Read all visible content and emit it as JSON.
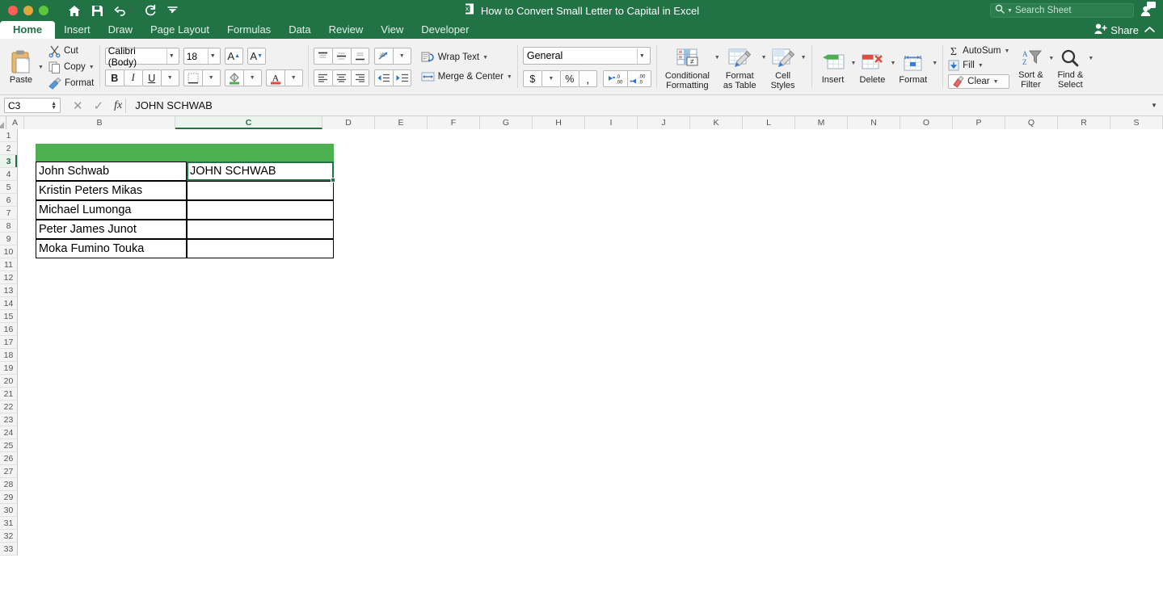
{
  "window": {
    "title": "How to Convert Small Letter to Capital in Excel",
    "doc_icon": "excel-document-icon",
    "traffic_lights": [
      "close",
      "minimize",
      "maximize"
    ],
    "quick_access": [
      {
        "name": "home-icon",
        "label": "Home"
      },
      {
        "name": "save-icon",
        "label": "Save"
      },
      {
        "name": "undo-icon",
        "label": "Undo"
      },
      {
        "name": "redo-icon",
        "label": "Redo"
      },
      {
        "name": "customize-toolbar-icon",
        "label": "Customize"
      }
    ],
    "search": {
      "placeholder": "Search Sheet",
      "icon": "search-icon"
    },
    "share_label": "Share",
    "account_icon": "account-comment-icon",
    "collapse_icon": "chevron-up-icon"
  },
  "tabs": [
    {
      "label": "Home",
      "active": true
    },
    {
      "label": "Insert",
      "active": false
    },
    {
      "label": "Draw",
      "active": false
    },
    {
      "label": "Page Layout",
      "active": false
    },
    {
      "label": "Formulas",
      "active": false
    },
    {
      "label": "Data",
      "active": false
    },
    {
      "label": "Review",
      "active": false
    },
    {
      "label": "View",
      "active": false
    },
    {
      "label": "Developer",
      "active": false
    }
  ],
  "ribbon": {
    "clipboard": {
      "paste": "Paste",
      "cut": "Cut",
      "copy": "Copy",
      "format_painter": "Format"
    },
    "font": {
      "name": "Calibri (Body)",
      "size": "18",
      "grow_label": "A",
      "shrink_label": "A",
      "bold": "B",
      "italic": "I",
      "underline": "U",
      "fill_color": "#4CAF50",
      "font_color": "#E8453C"
    },
    "alignment": {
      "wrap_text": "Wrap Text",
      "merge_center": "Merge & Center",
      "vertical_selected": "bottom",
      "horizontal_selected": "none"
    },
    "number": {
      "format": "General",
      "currency": "$",
      "percent": "%",
      "comma": ",",
      "increase_decimal": ".00",
      "decrease_decimal": ".0"
    },
    "styles": {
      "conditional_formatting": "Conditional\nFormatting",
      "conditional_formatting_l1": "Conditional",
      "conditional_formatting_l2": "Formatting",
      "format_as_table_l1": "Format",
      "format_as_table_l2": "as Table",
      "cell_styles_l1": "Cell",
      "cell_styles_l2": "Styles"
    },
    "cells": {
      "insert": "Insert",
      "delete": "Delete",
      "format": "Format"
    },
    "editing": {
      "autosum": "AutoSum",
      "fill": "Fill",
      "clear": "Clear",
      "sort_filter_l1": "Sort &",
      "sort_filter_l2": "Filter",
      "find_select_l1": "Find &",
      "find_select_l2": "Select"
    }
  },
  "formula_bar": {
    "name_box": "C3",
    "cancel_icon": "cancel-icon",
    "enter_icon": "check-icon",
    "function_icon": "fx",
    "content": "JOHN SCHWAB"
  },
  "sheet": {
    "columns": [
      "A",
      "B",
      "C",
      "D",
      "E",
      "F",
      "G",
      "H",
      "I",
      "J",
      "K",
      "L",
      "M",
      "N",
      "O",
      "P",
      "Q",
      "R",
      "S"
    ],
    "selected_column": "C",
    "rows": [
      1,
      2,
      3,
      4,
      5,
      6,
      7,
      8,
      9,
      10,
      11,
      12,
      13,
      14,
      15,
      16,
      17,
      18,
      19,
      20,
      21,
      22,
      23,
      24,
      25,
      26,
      27,
      28,
      29,
      30,
      31,
      32,
      33
    ],
    "selected_row": 3,
    "active_cell": "C3",
    "header_fill": "#4CAF50",
    "selection_color": "#217346",
    "cells": [
      {
        "ref": "B2",
        "value": "",
        "header": true
      },
      {
        "ref": "C2",
        "value": "",
        "header": true
      },
      {
        "ref": "B3",
        "value": "John Schwab",
        "header": false
      },
      {
        "ref": "C3",
        "value": "JOHN SCHWAB",
        "header": false
      },
      {
        "ref": "B4",
        "value": "Kristin Peters Mikas",
        "header": false
      },
      {
        "ref": "C4",
        "value": "",
        "header": false
      },
      {
        "ref": "B5",
        "value": "Michael Lumonga",
        "header": false
      },
      {
        "ref": "C5",
        "value": "",
        "header": false
      },
      {
        "ref": "B6",
        "value": "Peter James Junot",
        "header": false
      },
      {
        "ref": "C6",
        "value": "",
        "header": false
      },
      {
        "ref": "B7",
        "value": "Moka Fumino Touka",
        "header": false
      },
      {
        "ref": "C7",
        "value": "",
        "header": false
      }
    ]
  }
}
